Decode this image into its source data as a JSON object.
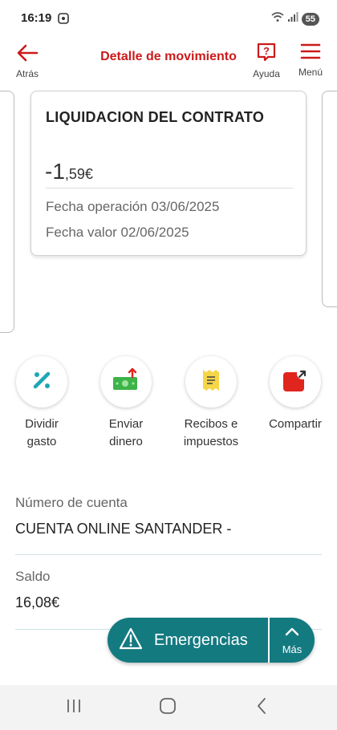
{
  "status_bar": {
    "time": "16:19",
    "battery": "55"
  },
  "header": {
    "back_label": "Atrás",
    "title": "Detalle de movimiento",
    "help_label": "Ayuda",
    "menu_label": "Menú"
  },
  "card": {
    "title": "LIQUIDACION DEL CONTRATO",
    "amount_int": "-1",
    "amount_dec": ",59€",
    "operation_date": "Fecha operación 03/06/2025",
    "value_date": "Fecha valor 02/06/2025"
  },
  "actions": [
    {
      "line1": "Dividir",
      "line2": "gasto",
      "icon": "split-expense-icon"
    },
    {
      "line1": "Enviar",
      "line2": "dinero",
      "icon": "send-money-icon"
    },
    {
      "line1": "Recibos e",
      "line2": "impuestos",
      "icon": "receipt-icon"
    },
    {
      "line1": "Compartir",
      "line2": "",
      "icon": "share-icon"
    }
  ],
  "account": {
    "label": "Número de cuenta",
    "value": "CUENTA ONLINE SANTANDER -"
  },
  "balance": {
    "label": "Saldo",
    "value": "16,08€"
  },
  "emergency": {
    "label": "Emergencias",
    "more_label": "Más"
  },
  "colors": {
    "brand_red": "#cc1a1a",
    "teal": "#137a80"
  }
}
